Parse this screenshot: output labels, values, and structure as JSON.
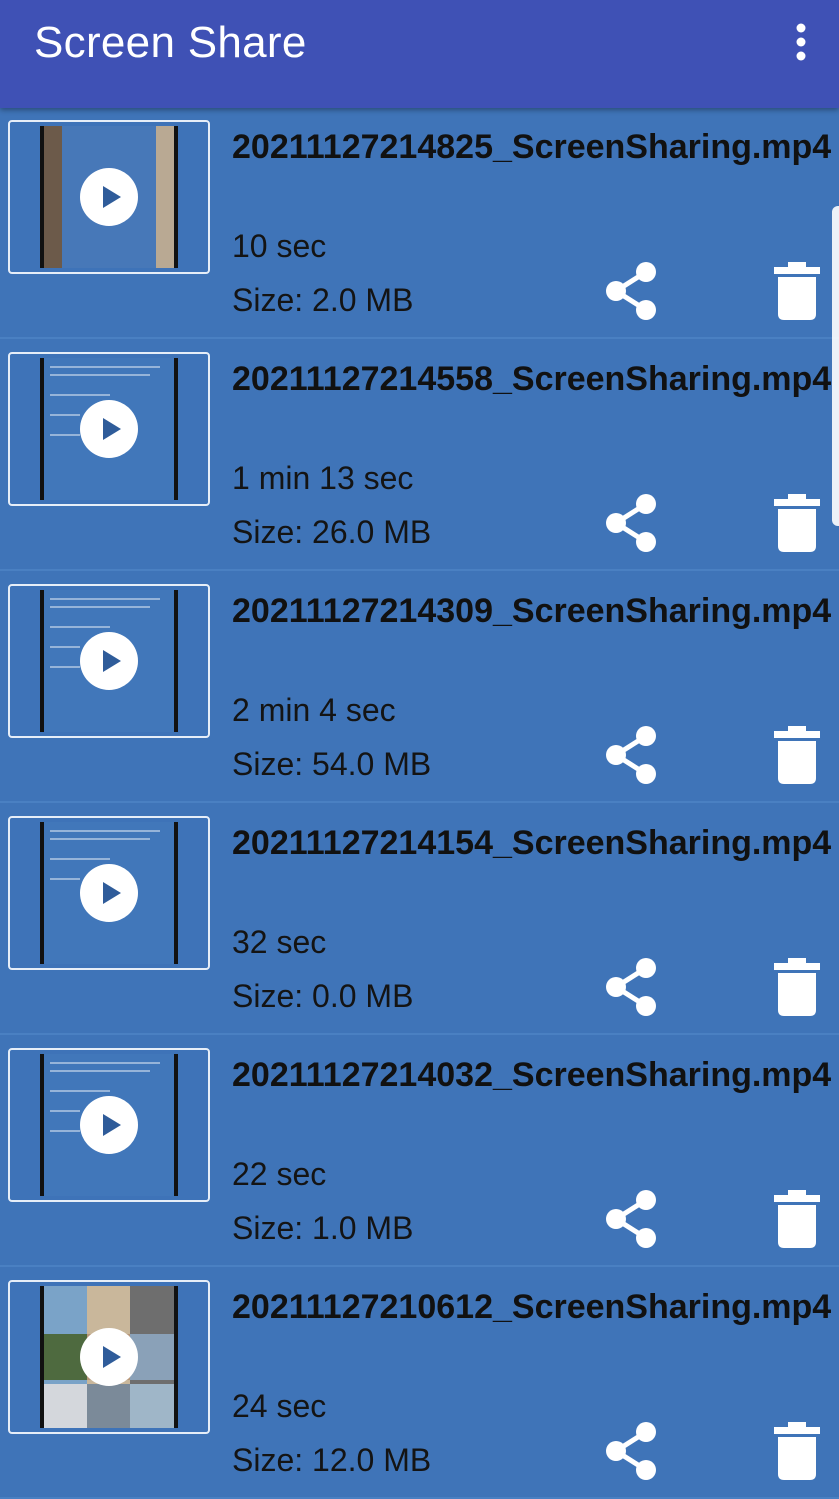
{
  "app": {
    "title": "Screen Share"
  },
  "colors": {
    "appbar": "#3F51B5",
    "background": "#3F74B8"
  },
  "icons": {
    "overflow": "more-vert-icon",
    "play": "play-icon",
    "share": "share-icon",
    "delete": "delete-icon"
  },
  "recordings": [
    {
      "name": "20211127214825_ScreenSharing.mp4",
      "duration": "10 sec",
      "size": "Size: 2.0 MB"
    },
    {
      "name": "20211127214558_ScreenSharing.mp4",
      "duration": "1 min 13 sec",
      "size": "Size: 26.0 MB"
    },
    {
      "name": "20211127214309_ScreenSharing.mp4",
      "duration": "2 min 4 sec",
      "size": "Size: 54.0 MB"
    },
    {
      "name": "20211127214154_ScreenSharing.mp4",
      "duration": "32 sec",
      "size": "Size: 0.0 MB"
    },
    {
      "name": "20211127214032_ScreenSharing.mp4",
      "duration": "22 sec",
      "size": "Size: 1.0 MB"
    },
    {
      "name": "20211127210612_ScreenSharing.mp4",
      "duration": "24 sec",
      "size": "Size: 12.0 MB"
    }
  ]
}
